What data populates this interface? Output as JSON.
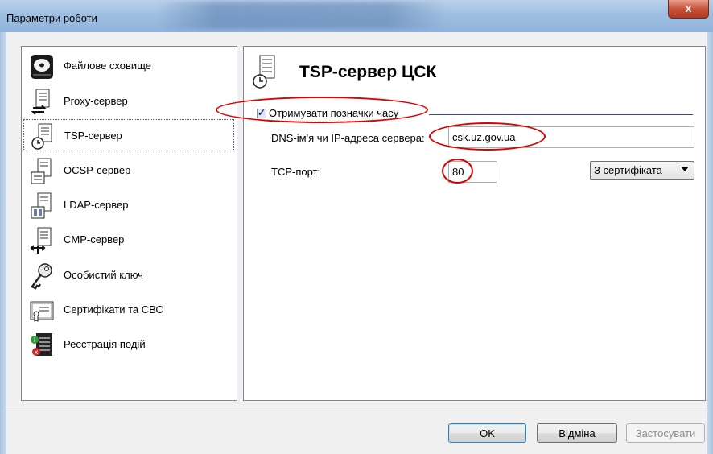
{
  "window": {
    "title": "Параметри роботи",
    "close_glyph": "x"
  },
  "sidebar": {
    "items": [
      {
        "label": "Файлове сховище",
        "icon": "drive-icon"
      },
      {
        "label": "Proxy-сервер",
        "icon": "proxy-server-icon"
      },
      {
        "label": "TSP-сервер",
        "icon": "tsp-server-icon"
      },
      {
        "label": "OCSP-сервер",
        "icon": "ocsp-server-icon"
      },
      {
        "label": "LDAP-сервер",
        "icon": "ldap-server-icon"
      },
      {
        "label": "CMP-сервер",
        "icon": "cmp-server-icon"
      },
      {
        "label": "Особистий ключ",
        "icon": "key-icon"
      },
      {
        "label": "Сертифікати та СВС",
        "icon": "certificate-icon"
      },
      {
        "label": "Реєстрація подій",
        "icon": "event-log-icon"
      }
    ],
    "selected": "TSP-сервер"
  },
  "panel": {
    "title": "TSP-сервер ЦСК",
    "checkbox_label": "Отримувати позначки часу",
    "checkbox_checked": true,
    "dns_label": "DNS-ім'я чи IP-адреса сервера:",
    "dns_value": "csk.uz.gov.ua",
    "port_label": "TCP-порт:",
    "port_value": "80",
    "dropdown_value": "З сертифіката"
  },
  "buttons": {
    "ok": "OK",
    "cancel": "Відміна",
    "apply": "Застосувати"
  },
  "colors": {
    "annotation": "#d90000",
    "titlebar": "#9fbfe0",
    "close": "#c8513a"
  }
}
